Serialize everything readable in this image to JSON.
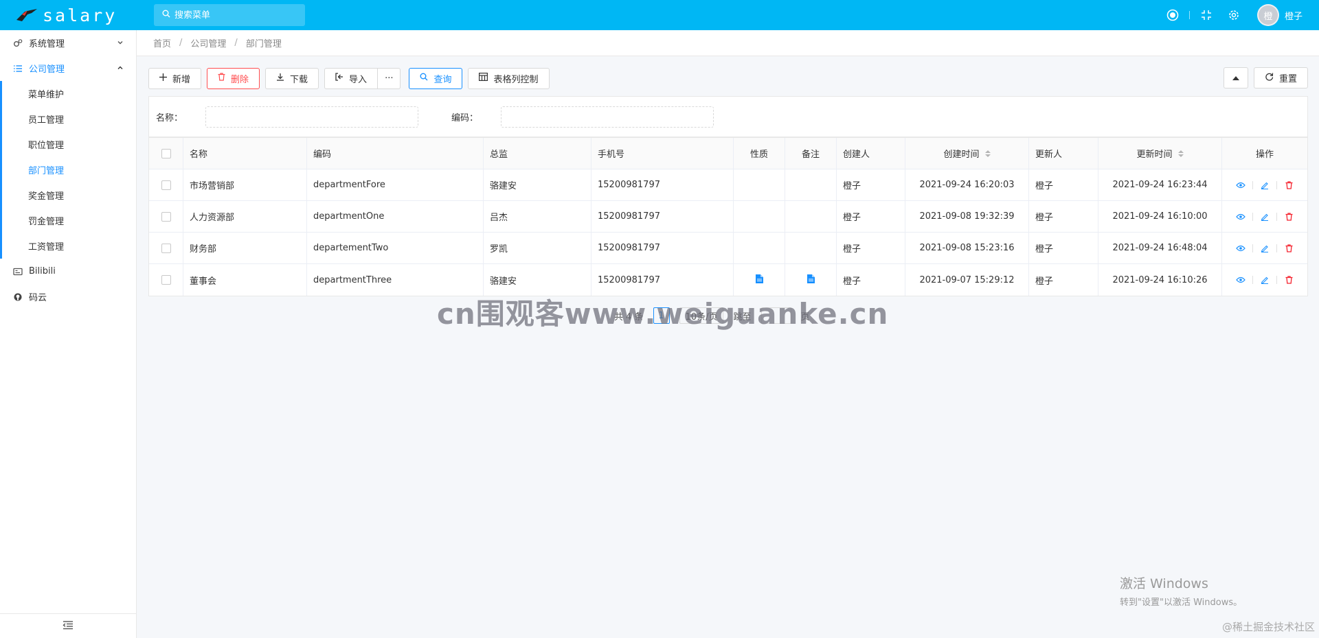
{
  "header": {
    "logo_text": "salary",
    "search_placeholder": "搜索菜单",
    "user_avatar_char": "橙",
    "user_name": "橙子"
  },
  "sidebar": {
    "items": [
      {
        "label": "系统管理",
        "icon": "gears-icon",
        "expanded": false
      },
      {
        "label": "公司管理",
        "icon": "list-icon",
        "expanded": true,
        "children": [
          {
            "label": "菜单维护",
            "active": false
          },
          {
            "label": "员工管理",
            "active": false
          },
          {
            "label": "职位管理",
            "active": false
          },
          {
            "label": "部门管理",
            "active": true
          },
          {
            "label": "奖金管理",
            "active": false
          },
          {
            "label": "罚金管理",
            "active": false
          },
          {
            "label": "工资管理",
            "active": false
          }
        ]
      },
      {
        "label": "Bilibili",
        "icon": "bilibili-icon"
      },
      {
        "label": "码云",
        "icon": "github-icon"
      }
    ]
  },
  "breadcrumb": [
    "首页",
    "公司管理",
    "部门管理"
  ],
  "toolbar": {
    "add": "新增",
    "delete": "删除",
    "download": "下载",
    "import": "导入",
    "more": "···",
    "query": "查询",
    "columns": "表格列控制",
    "reset": "重置"
  },
  "filter": {
    "name_label": "名称：",
    "code_label": "编码："
  },
  "table": {
    "columns": [
      "名称",
      "编码",
      "总监",
      "手机号",
      "性质",
      "备注",
      "创建人",
      "创建时间",
      "更新人",
      "更新时间",
      "操作"
    ],
    "rows": [
      {
        "name": "市场营销部",
        "code": "departmentFore",
        "director": "骆建安",
        "phone": "15200981797",
        "nature_doc": false,
        "remark_doc": false,
        "creator": "橙子",
        "created": "2021-09-24 16:20:03",
        "updater": "橙子",
        "updated": "2021-09-24 16:23:44"
      },
      {
        "name": "人力资源部",
        "code": "departmentOne",
        "director": "吕杰",
        "phone": "15200981797",
        "nature_doc": false,
        "remark_doc": false,
        "creator": "橙子",
        "created": "2021-09-08 19:32:39",
        "updater": "橙子",
        "updated": "2021-09-24 16:10:00"
      },
      {
        "name": "财务部",
        "code": "departementTwo",
        "director": "罗凯",
        "phone": "15200981797",
        "nature_doc": false,
        "remark_doc": false,
        "creator": "橙子",
        "created": "2021-09-08 15:23:16",
        "updater": "橙子",
        "updated": "2021-09-24 16:48:04"
      },
      {
        "name": "董事会",
        "code": "departmentThree",
        "director": "骆建安",
        "phone": "15200981797",
        "nature_doc": true,
        "remark_doc": true,
        "creator": "橙子",
        "created": "2021-09-07 15:29:12",
        "updater": "橙子",
        "updated": "2021-09-24 16:10:26"
      }
    ]
  },
  "pagination": {
    "total_text": "共 4 条",
    "current_page": "1",
    "page_size": "10条/页",
    "goto_label": "跳至",
    "page_suffix": "页"
  },
  "overlays": {
    "watermark": "cn围观客www.weiguanke.cn",
    "activate_title": "激活 Windows",
    "activate_sub": "转到\"设置\"以激活 Windows。",
    "juejin": "@稀土掘金技术社区"
  },
  "colors": {
    "header_bg": "#00b7f4",
    "accent": "#1890ff",
    "danger": "#ff4d4f"
  }
}
